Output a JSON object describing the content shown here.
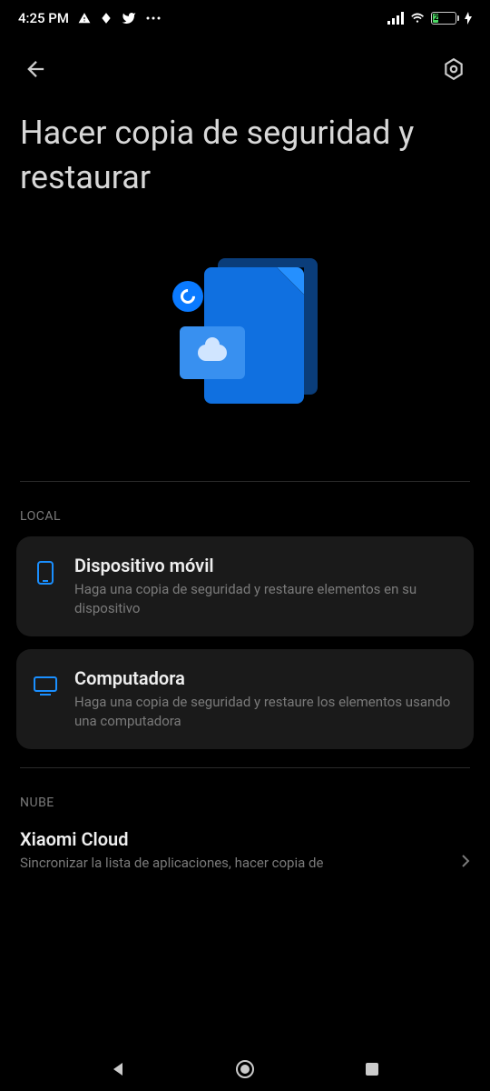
{
  "statusBar": {
    "time": "4:25 PM",
    "batteryPercent": "25"
  },
  "header": {
    "title": "Hacer copia de seguridad y restaurar"
  },
  "sections": {
    "local": {
      "header": "LOCAL",
      "items": [
        {
          "title": "Dispositivo móvil",
          "desc": "Haga una copia de seguridad y restaure elementos en su dispositivo"
        },
        {
          "title": "Computadora",
          "desc": "Haga una copia de seguridad y restaure los elementos usando una computadora"
        }
      ]
    },
    "cloud": {
      "header": "NUBE",
      "items": [
        {
          "title": "Xiaomi Cloud",
          "desc": "Sincronizar la lista de aplicaciones, hacer copia de"
        }
      ]
    }
  }
}
